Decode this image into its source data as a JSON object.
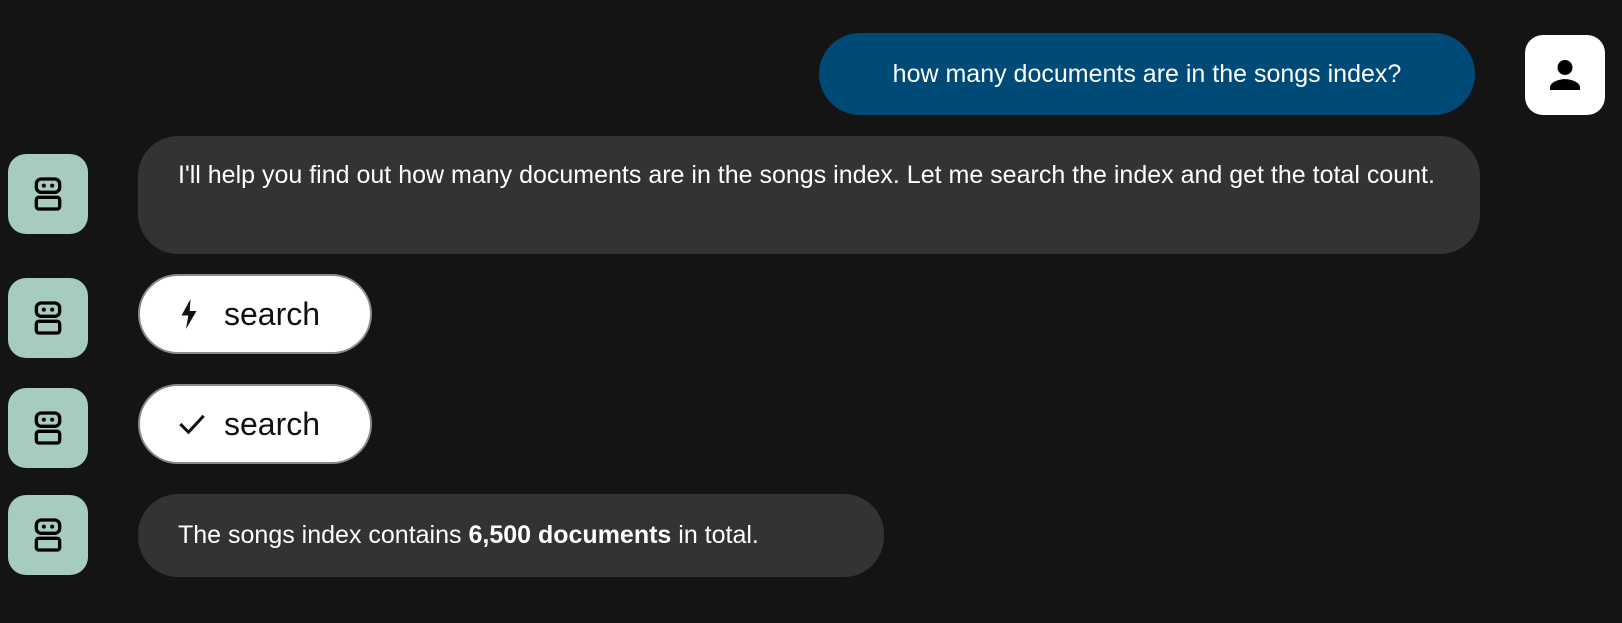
{
  "conversation": {
    "user_message": "how many documents are in the songs index?",
    "assistant_message_1": "I'll help you find out how many documents are in the songs index. Let me search the index and get the total count.",
    "tool_call_running": {
      "icon": "bolt-icon",
      "label": "search"
    },
    "tool_call_done": {
      "icon": "check-icon",
      "label": "search"
    },
    "final_answer": {
      "prefix": "The songs index contains ",
      "highlight": "6,500 documents",
      "suffix": " in total."
    }
  },
  "colors": {
    "background": "#141414",
    "user_bubble": "#004a77",
    "assistant_bubble": "#333333",
    "bot_avatar": "#a6cbbf",
    "user_avatar": "#ffffff",
    "tool_pill": "#ffffff"
  },
  "avatars": {
    "user_icon": "person-icon",
    "bot_icon": "robot-icon"
  }
}
